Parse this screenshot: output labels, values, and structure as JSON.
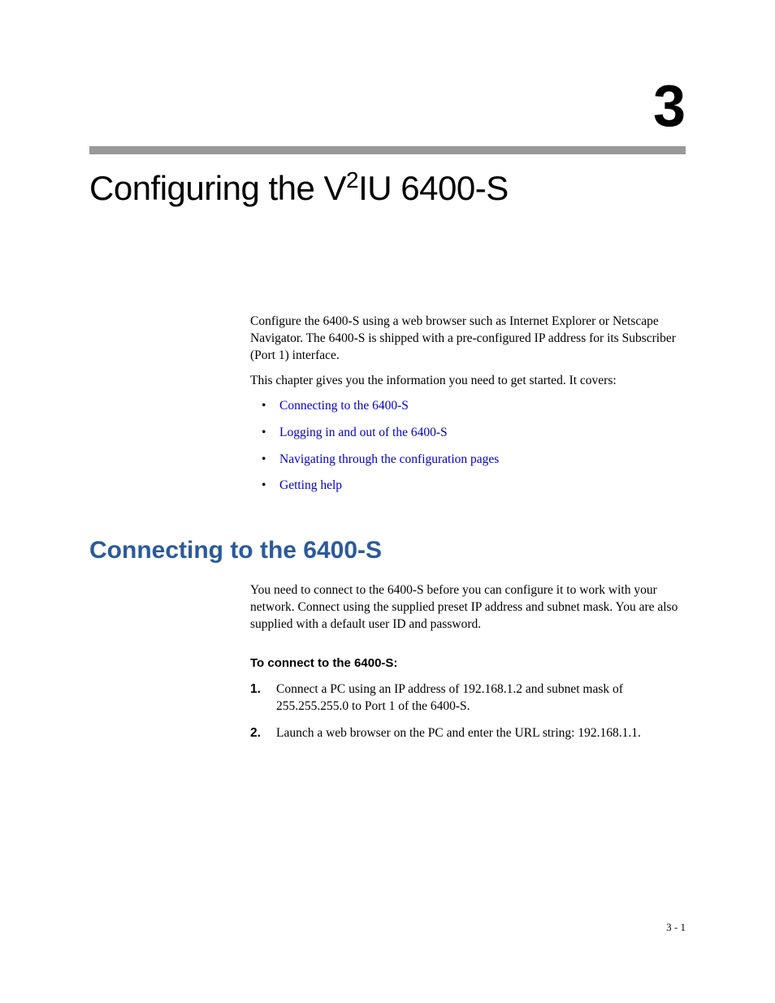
{
  "chapter": {
    "number": "3",
    "title_pre": "Configuring the V",
    "title_sup": "2",
    "title_post": "IU 6400-S"
  },
  "intro": {
    "p1": "Configure the 6400-S using a web browser such as Internet Explorer or Netscape Navigator. The 6400-S is shipped with a pre-configured IP address for its Subscriber (Port 1) interface.",
    "p2": "This chapter gives you the information you need to get started. It covers:",
    "links": [
      "Connecting to the 6400-S",
      "Logging in and out of the 6400-S",
      "Navigating through the configuration pages",
      "Getting help"
    ]
  },
  "section": {
    "heading": "Connecting to the 6400-S",
    "p1": "You need to connect to the 6400-S before you can configure it to work with your network. Connect using the supplied preset IP address and subnet mask. You are also supplied with a default user ID and password.",
    "proc_heading": "To connect to the 6400-S:",
    "steps": [
      {
        "num": "1.",
        "text": "Connect a PC using an IP address of 192.168.1.2 and subnet mask of 255.255.255.0 to Port 1 of the 6400-S."
      },
      {
        "num": "2.",
        "text": "Launch a web browser on the PC and enter the URL string: 192.168.1.1."
      }
    ]
  },
  "page_number": "3 - 1"
}
